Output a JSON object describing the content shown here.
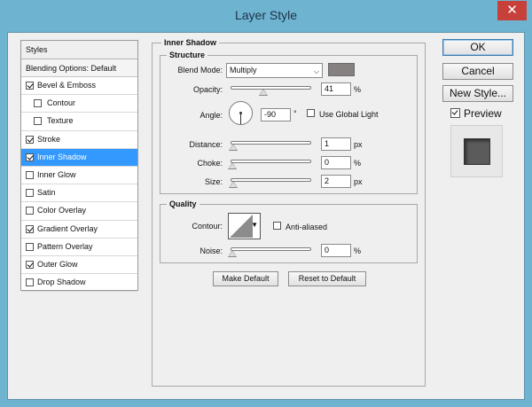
{
  "window": {
    "title": "Layer Style",
    "close_glyph": "✕"
  },
  "styles_panel": {
    "header": "Styles",
    "blending_options": "Blending Options: Default",
    "items": [
      {
        "label": "Bevel & Emboss",
        "checked": true,
        "indent": false,
        "active": false
      },
      {
        "label": "Contour",
        "checked": false,
        "indent": true,
        "active": false
      },
      {
        "label": "Texture",
        "checked": false,
        "indent": true,
        "active": false
      },
      {
        "label": "Stroke",
        "checked": true,
        "indent": false,
        "active": false
      },
      {
        "label": "Inner Shadow",
        "checked": true,
        "indent": false,
        "active": true
      },
      {
        "label": "Inner Glow",
        "checked": false,
        "indent": false,
        "active": false
      },
      {
        "label": "Satin",
        "checked": false,
        "indent": false,
        "active": false
      },
      {
        "label": "Color Overlay",
        "checked": false,
        "indent": false,
        "active": false
      },
      {
        "label": "Gradient Overlay",
        "checked": true,
        "indent": false,
        "active": false
      },
      {
        "label": "Pattern Overlay",
        "checked": false,
        "indent": false,
        "active": false
      },
      {
        "label": "Outer Glow",
        "checked": true,
        "indent": false,
        "active": false
      },
      {
        "label": "Drop Shadow",
        "checked": false,
        "indent": false,
        "active": false
      }
    ]
  },
  "inner_shadow": {
    "group_title": "Inner Shadow",
    "structure": {
      "title": "Structure",
      "blend_mode_label": "Blend Mode:",
      "blend_mode_value": "Multiply",
      "shadow_color": "#868181",
      "opacity_label": "Opacity:",
      "opacity_value": "41",
      "opacity_level": 0.41,
      "opacity_unit": "%",
      "angle_label": "Angle:",
      "angle_value": "-90",
      "angle_unit": "°",
      "use_global_light": "Use Global Light",
      "use_global_light_checked": false,
      "distance_label": "Distance:",
      "distance_value": "1",
      "distance_unit": "px",
      "choke_label": "Choke:",
      "choke_value": "0",
      "choke_unit": "%",
      "size_label": "Size:",
      "size_value": "2",
      "size_unit": "px"
    },
    "quality": {
      "title": "Quality",
      "contour_label": "Contour:",
      "anti_aliased": "Anti-aliased",
      "anti_aliased_checked": false,
      "noise_label": "Noise:",
      "noise_value": "0",
      "noise_unit": "%"
    },
    "make_default": "Make Default",
    "reset_to_default": "Reset to Default"
  },
  "side": {
    "ok": "OK",
    "cancel": "Cancel",
    "new_style": "New Style...",
    "preview": "Preview",
    "preview_checked": true
  }
}
